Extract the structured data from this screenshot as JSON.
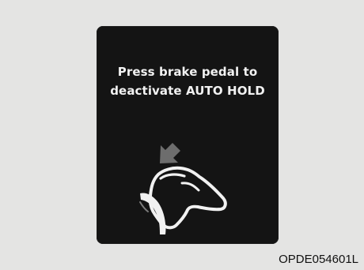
{
  "display": {
    "message_line_1": "Press brake pedal to",
    "message_line_2": "deactivate AUTO HOLD",
    "icon": "foot-pressing-brake-pedal-icon",
    "arrow_icon": "down-left-arrow-icon"
  },
  "caption": {
    "code": "OPDE054601L"
  },
  "colors": {
    "background": "#e4e4e3",
    "panel": "#141414",
    "text": "#f2f2f2",
    "icon_primary": "#f1f1f1",
    "arrow": "#6b6b6b"
  }
}
